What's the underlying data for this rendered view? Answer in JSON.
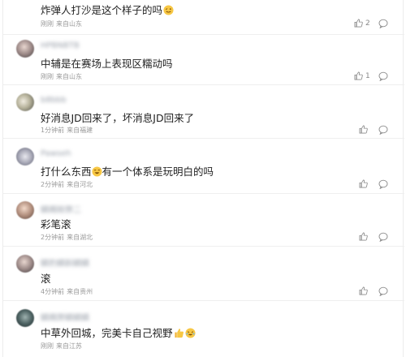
{
  "comments": [
    {
      "username": "",
      "text": "炸弹人打沙是这个样子的吗",
      "emoji": "wink-emoji",
      "time": "刚刚",
      "location": "来自山东",
      "likes": "2"
    },
    {
      "username": "HPBNBTB",
      "text": "中辅是在赛场上表现区糯动吗",
      "time": "刚刚",
      "location": "来自山东",
      "likes": "1"
    },
    {
      "username": "b8bbb",
      "text": "好消息JD回来了，坏消息JD回来了",
      "time": "1分钟前",
      "location": "来自福建",
      "likes": ""
    },
    {
      "username": "Pawseh",
      "text_before": "打什么东西",
      "emoji": "laugh-emoji",
      "text_after": "有一个体系是玩明白的吗",
      "time": "2分钟前",
      "location": "来自河北",
      "likes": ""
    },
    {
      "username": "鳞赐赊弊二",
      "text": "彩笔滚",
      "time": "2分钟前",
      "location": "来自湖北",
      "likes": ""
    },
    {
      "username": "鳞豹鳞斟鳞鳞",
      "text": "滚",
      "time": "4分钟前",
      "location": "来自贵州",
      "likes": ""
    },
    {
      "username": "鳞赐弊鳞鳞鳞",
      "text": "中草外回城，完美卡自己视野",
      "emojis": [
        "thumbs-up-emoji",
        "cry-laugh-emoji"
      ],
      "time": "刚刚",
      "location": "来自江苏",
      "likes": ""
    }
  ],
  "colors": {
    "text": "#222222",
    "meta": "#9a9a9a",
    "divider": "#efefef"
  }
}
